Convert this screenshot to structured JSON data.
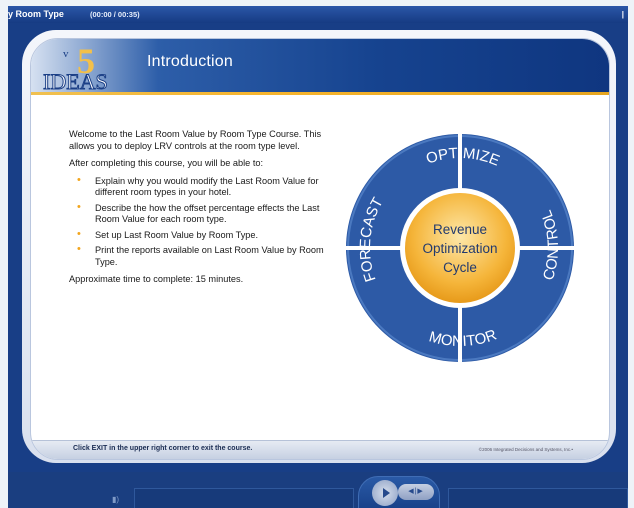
{
  "titlebar": {
    "title": "y Room Type",
    "time": "(00:00 / 00:35)",
    "end_mark": "|"
  },
  "logo": {
    "text": "IDEAS",
    "vertical_letter": "v",
    "number": "5"
  },
  "header": {
    "title": "Introduction"
  },
  "content": {
    "intro": "Welcome to the Last Room Value by Room Type Course. This allows you to deploy LRV controls at the room type level.",
    "lead": "After completing this course, you will be able to:",
    "bullets": [
      "Explain why you would modify the Last Room Value for different room types in your hotel.",
      "Describe the how the offset percentage effects the Last Room Value for each room type.",
      "Set up Last Room Value by Room Type.",
      "Print the reports available on Last Room Value by Room Type."
    ],
    "time_note": "Approximate time to complete: 15 minutes."
  },
  "cycle": {
    "center_lines": [
      "Revenue",
      "Optimization",
      "Cycle"
    ],
    "segments": [
      "FORECAST",
      "OPTIMIZE",
      "CONTROL",
      "MONITOR"
    ]
  },
  "footer": {
    "exit_note": "Click EXIT in the upper right corner to exit the course.",
    "copyright": "©2006 Integrated Decisions and Systems, Inc.•"
  },
  "controls": {
    "speaker_icon": "speaker-icon",
    "skip_label": "◀|▶"
  },
  "colors": {
    "frame_blue": "#183e86",
    "accent_gold": "#f2a51d",
    "cycle_blue": "#2d5aa6"
  }
}
